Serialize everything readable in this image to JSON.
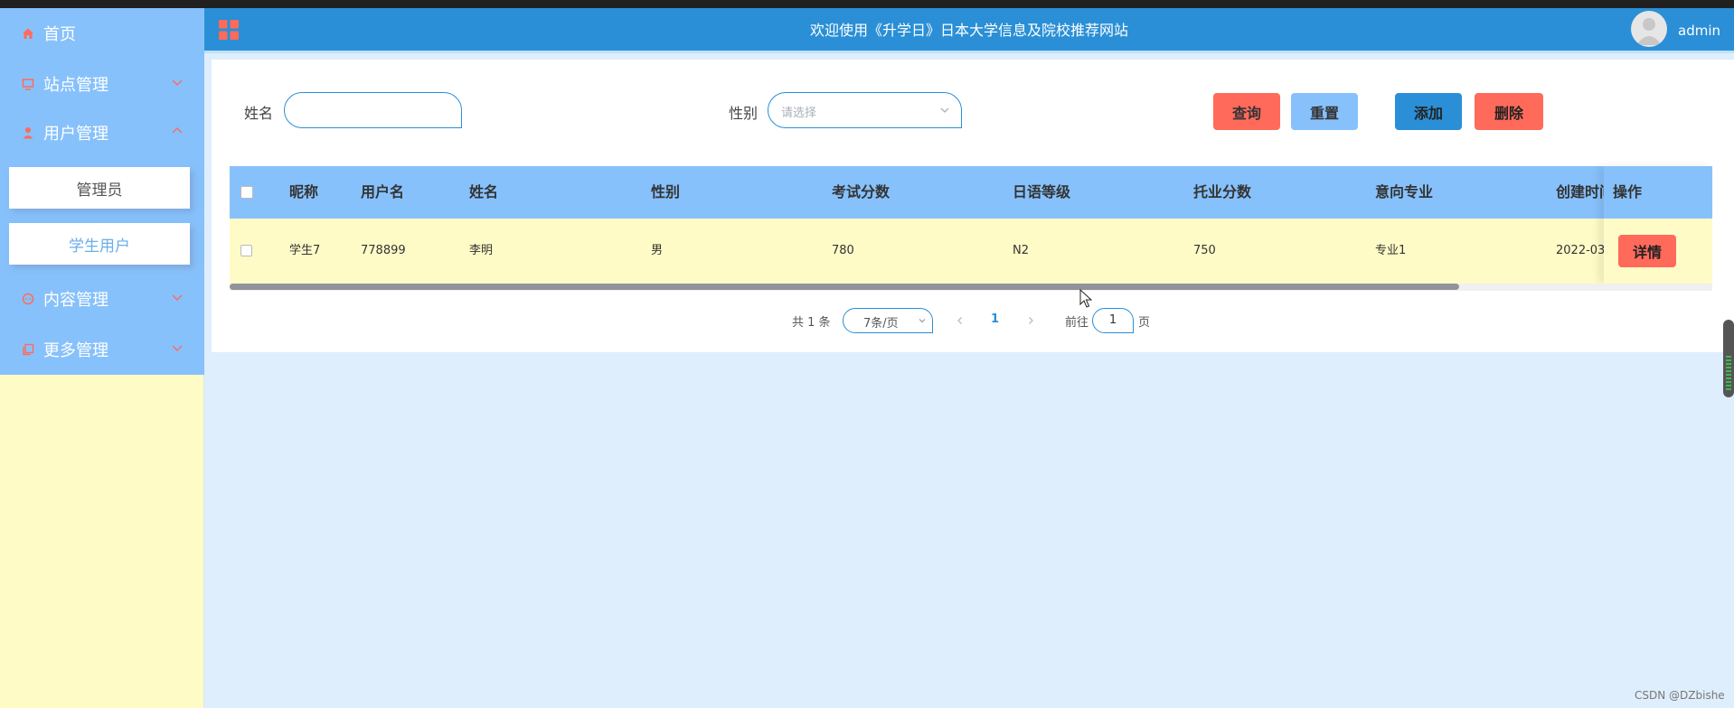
{
  "header": {
    "title": "欢迎使用《升学日》日本大学信息及院校推荐网站",
    "username": "admin"
  },
  "sidebar": {
    "items": [
      {
        "label": "首页",
        "icon": "home-icon"
      },
      {
        "label": "站点管理",
        "icon": "monitor-icon"
      },
      {
        "label": "用户管理",
        "icon": "user-icon"
      },
      {
        "label": "内容管理",
        "icon": "chat-icon"
      },
      {
        "label": "更多管理",
        "icon": "copy-icon"
      }
    ],
    "submenu": [
      {
        "label": "管理员"
      },
      {
        "label": "学生用户"
      }
    ]
  },
  "search": {
    "name_label": "姓名",
    "name_value": "",
    "gender_label": "性别",
    "gender_placeholder": "请选择"
  },
  "buttons": {
    "query": "查询",
    "reset": "重置",
    "add": "添加",
    "delete": "删除"
  },
  "table": {
    "columns": [
      "昵称",
      "用户名",
      "姓名",
      "性别",
      "考试分数",
      "日语等级",
      "托业分数",
      "意向专业",
      "创建时间",
      "操作"
    ],
    "rows": [
      {
        "nickname": "学生7",
        "username": "778899",
        "name": "李明",
        "gender": "男",
        "score": "780",
        "jlpt": "N2",
        "toeic": "750",
        "major": "专业1",
        "created": "2022-03-",
        "action": "详情"
      }
    ]
  },
  "pagination": {
    "total": "共 1 条",
    "page_size": "7条/页",
    "current": "1",
    "goto_label": "前往",
    "goto_value": "1",
    "page_suffix": "页"
  },
  "watermark": "CSDN @DZbishe",
  "colors": {
    "sidebar_blue": "#87c1fb",
    "header_blue": "#2a8fd6",
    "row_yellow": "#fffbc7",
    "danger": "#ff6a5b"
  }
}
